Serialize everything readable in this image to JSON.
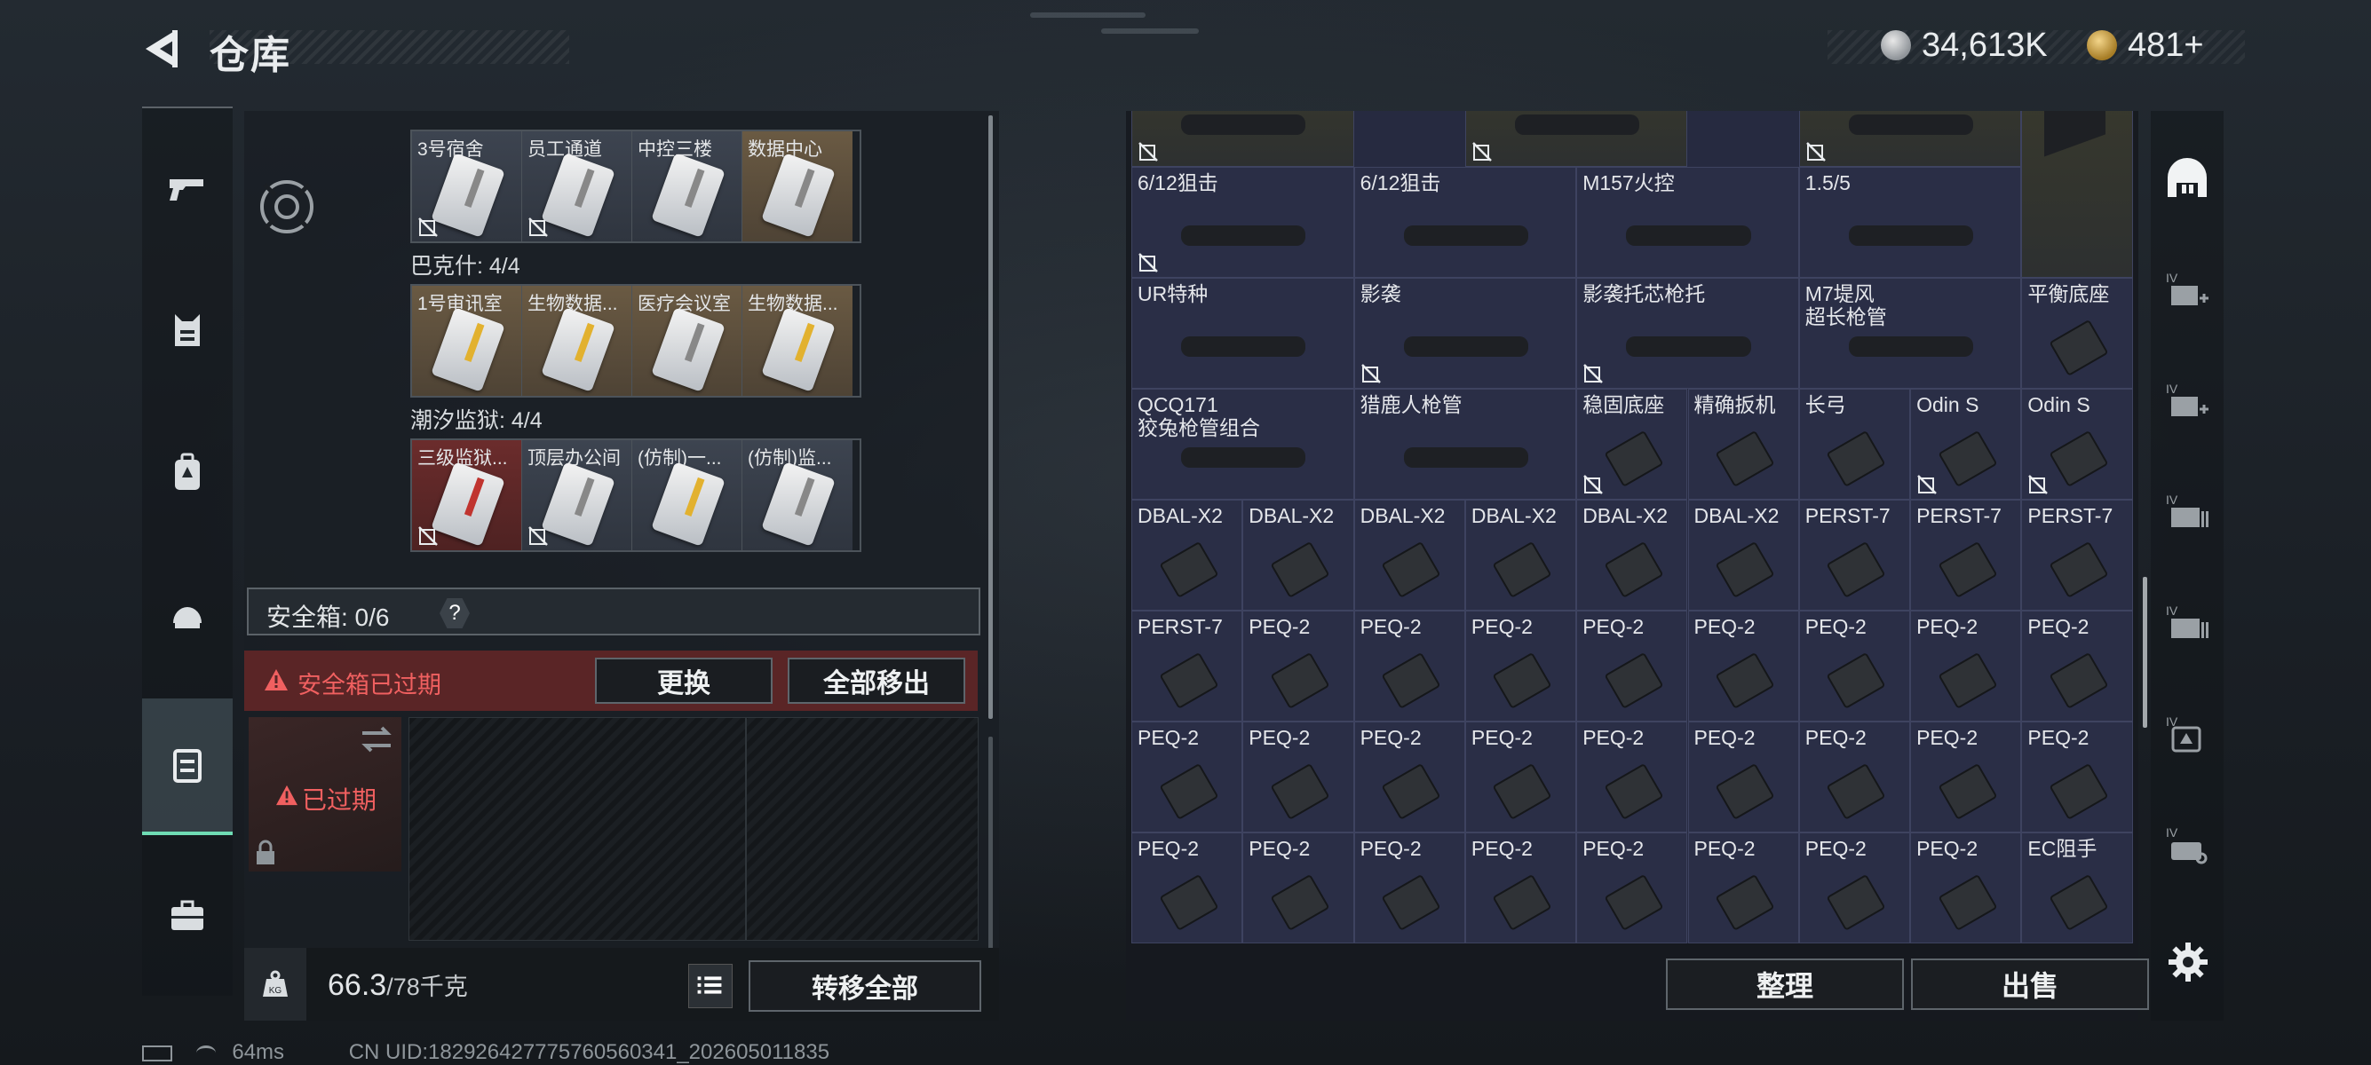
{
  "header": {
    "title": "仓库"
  },
  "currency": {
    "silver": "34,613K",
    "gold": "481+"
  },
  "left": {
    "groups": [
      {
        "label": "",
        "keys": [
          {
            "name": "3号宿舍",
            "tint": "gray",
            "strip": "none",
            "noloot": true
          },
          {
            "name": "员工通道",
            "tint": "gray",
            "strip": "none",
            "noloot": true
          },
          {
            "name": "中控三楼",
            "tint": "gray",
            "strip": "none",
            "noloot": false
          },
          {
            "name": "数据中心",
            "tint": "gold",
            "strip": "none",
            "noloot": false
          }
        ]
      },
      {
        "label": "巴克什: 4/4",
        "keys": [
          {
            "name": "1号审讯室",
            "tint": "gold",
            "strip": "yellow",
            "noloot": false
          },
          {
            "name": "生物数据...",
            "tint": "gold",
            "strip": "yellow",
            "noloot": false
          },
          {
            "name": "医疗会议室",
            "tint": "gold",
            "strip": "none",
            "noloot": false
          },
          {
            "name": "生物数据...",
            "tint": "gold",
            "strip": "yellow",
            "noloot": false
          }
        ]
      },
      {
        "label": "潮汐监狱: 4/4",
        "keys": [
          {
            "name": "三级监狱...",
            "tint": "red",
            "strip": "red",
            "noloot": true
          },
          {
            "name": "顶层办公间",
            "tint": "gray",
            "strip": "none",
            "noloot": true
          },
          {
            "name": "(仿制)一...",
            "tint": "gray",
            "strip": "yellow",
            "noloot": false
          },
          {
            "name": "(仿制)监...",
            "tint": "gray",
            "strip": "none",
            "noloot": false
          }
        ]
      }
    ],
    "safebox": {
      "label": "安全箱: 0/6",
      "help": "?",
      "expired_banner": "安全箱已过期",
      "replace_btn": "更换",
      "remove_all_btn": "全部移出",
      "thumb_status": "已过期"
    },
    "footer": {
      "weight": "66.3",
      "capacity": "/78千克",
      "transfer_btn": "转移全部"
    }
  },
  "status": {
    "ping": "64ms",
    "uid": "CN UID:1829264277757605603​41_202605011835"
  },
  "right": {
    "items": [
      {
        "name": "",
        "noloot": true
      },
      {
        "name": "",
        "noloot": true
      },
      {
        "name": "",
        "noloot": true
      },
      {
        "name": "6/12狙击",
        "noloot": true
      },
      {
        "name": "6/12狙击",
        "noloot": false
      },
      {
        "name": "M157火控",
        "noloot": false
      },
      {
        "name": "1.5/5",
        "noloot": false
      },
      {
        "name": "",
        "noloot": false
      },
      {
        "name": "UR特种",
        "noloot": false
      },
      {
        "name": "影袭",
        "noloot": true
      },
      {
        "name": "影袭托芯枪托",
        "noloot": true
      },
      {
        "name": "M7堤风\n超长枪管",
        "noloot": false
      },
      {
        "name": "平衡底座",
        "noloot": false
      },
      {
        "name": "QCQ171\n狡兔枪管组合",
        "noloot": false
      },
      {
        "name": "猎鹿人枪管",
        "noloot": false
      },
      {
        "name": "稳固底座",
        "noloot": true
      },
      {
        "name": "精确扳机",
        "noloot": false
      },
      {
        "name": "长弓",
        "noloot": false
      },
      {
        "name": "Odin S",
        "noloot": true
      },
      {
        "name": "Odin S",
        "noloot": true
      },
      {
        "name": "DBAL-X2"
      },
      {
        "name": "DBAL-X2"
      },
      {
        "name": "DBAL-X2"
      },
      {
        "name": "DBAL-X2"
      },
      {
        "name": "DBAL-X2"
      },
      {
        "name": "DBAL-X2"
      },
      {
        "name": "PERST-7"
      },
      {
        "name": "PERST-7"
      },
      {
        "name": "PERST-7"
      },
      {
        "name": "PERST-7"
      },
      {
        "name": "PEQ-2"
      },
      {
        "name": "PEQ-2"
      },
      {
        "name": "PEQ-2"
      },
      {
        "name": "PEQ-2"
      },
      {
        "name": "PEQ-2"
      },
      {
        "name": "PEQ-2"
      },
      {
        "name": "PEQ-2"
      },
      {
        "name": "PEQ-2"
      },
      {
        "name": "PEQ-2"
      },
      {
        "name": "PEQ-2"
      },
      {
        "name": "PEQ-2"
      },
      {
        "name": "PEQ-2"
      },
      {
        "name": "PEQ-2"
      },
      {
        "name": "PEQ-2"
      },
      {
        "name": "PEQ-2"
      },
      {
        "name": "PEQ-2"
      },
      {
        "name": "PEQ-2"
      },
      {
        "name": "PEQ-2"
      },
      {
        "name": "PEQ-2"
      },
      {
        "name": "PEQ-2"
      },
      {
        "name": "PEQ-2"
      },
      {
        "name": "PEQ-2"
      },
      {
        "name": "PEQ-2"
      },
      {
        "name": "PEQ-2"
      },
      {
        "name": "PEQ-2"
      },
      {
        "name": "EC阻手"
      }
    ],
    "sort_btn": "整理",
    "sell_btn": "出售"
  },
  "colors": {
    "accent": "#6fdcb4",
    "warning": "#f06060",
    "grid_bg": "#262a40"
  }
}
